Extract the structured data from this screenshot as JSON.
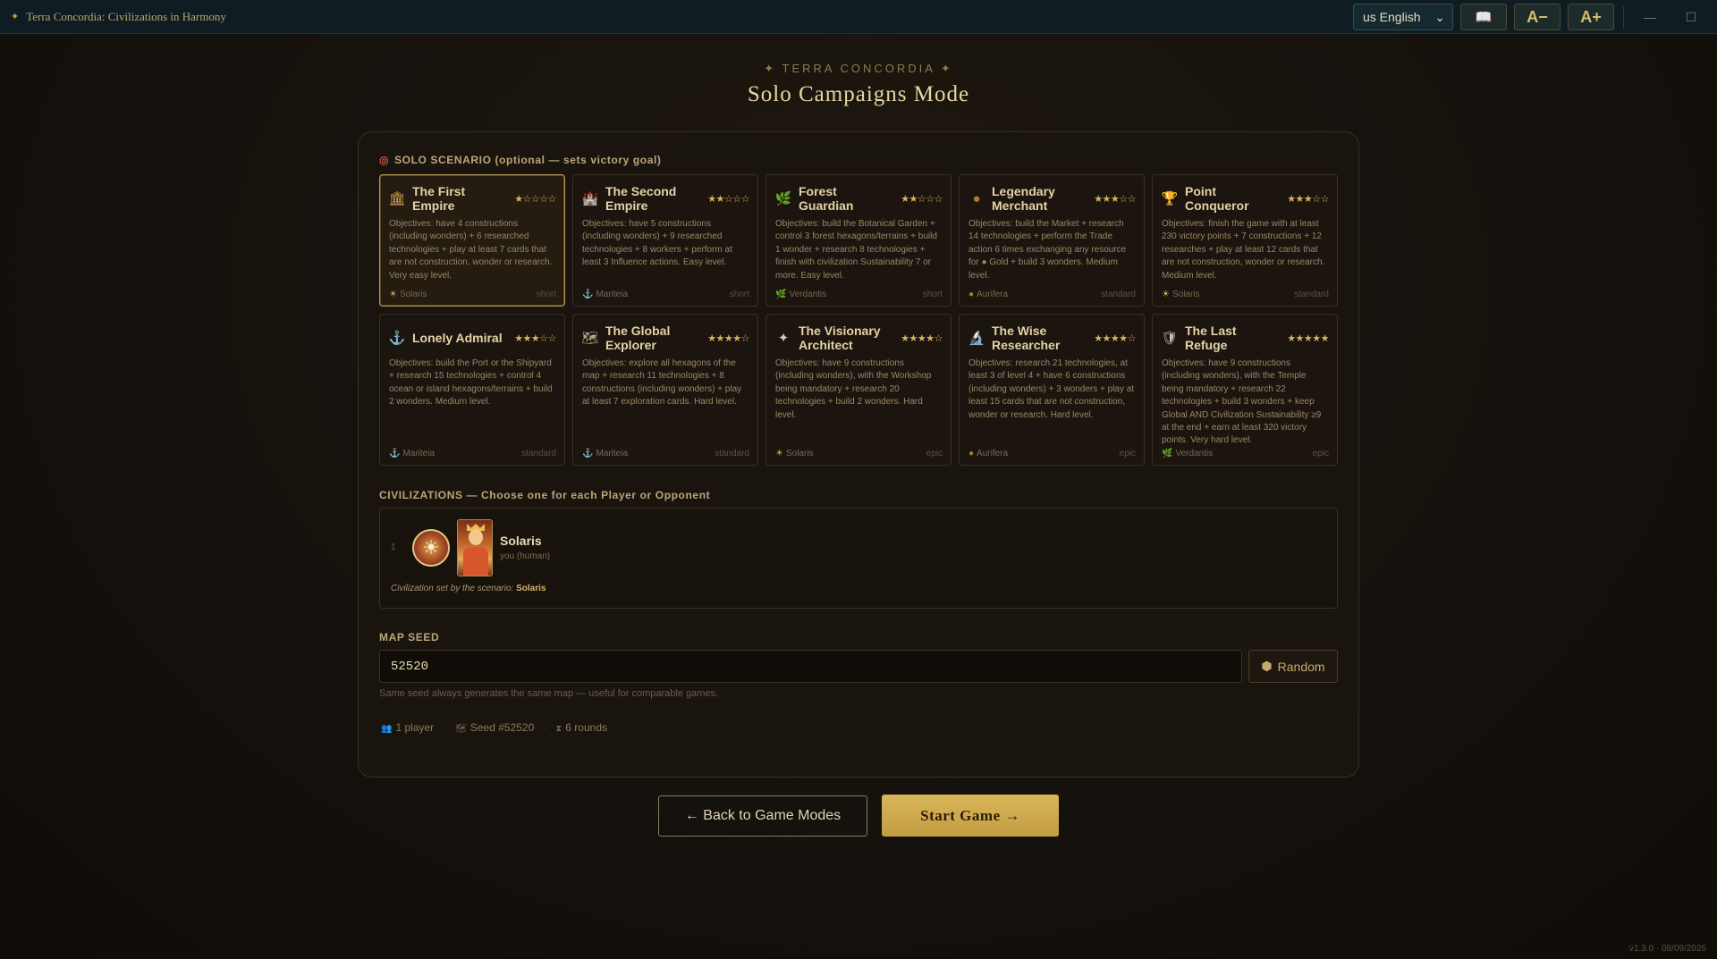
{
  "app": {
    "title": "Terra Concordia: Civilizations in Harmony",
    "language": "us English",
    "book_icon": "📖",
    "font_decrease": "A−",
    "font_increase": "A+",
    "minimize": "—",
    "maximize": "☐"
  },
  "header": {
    "eyebrow": "✦ TERRA CONCORDIA ✦",
    "title": "Solo Campaigns Mode"
  },
  "scenario_section": {
    "label": "SOLO SCENARIO (optional — sets victory goal)"
  },
  "scenarios": [
    {
      "icon": "🏛",
      "icon_name": "temple-icon",
      "title": "The First Empire",
      "stars": "★☆☆☆☆",
      "desc": "Objectives: have 4 constructions (including wonders) + 6 researched technologies + play at least 7 cards that are not construction, wonder or research. Very easy level.",
      "civ_icon": "☀",
      "civ": "Solaris",
      "length": "short",
      "selected": true
    },
    {
      "icon": "🏰",
      "icon_name": "castle-icon",
      "title": "The Second Empire",
      "stars": "★★☆☆☆",
      "desc": "Objectives: have 5 constructions (including wonders) + 9 researched technologies + 8 workers + perform at least 3 Influence actions. Easy level.",
      "civ_icon": "⚓",
      "civ": "Mariteia",
      "length": "short",
      "selected": false
    },
    {
      "icon": "🌿",
      "icon_name": "leaf-icon",
      "title": "Forest Guardian",
      "stars": "★★☆☆☆",
      "desc": "Objectives: build the Botanical Garden + control 3 forest hexagons/terrains + build 1 wonder + research 8 technologies + finish with civilization Sustainability 7 or more. Easy level.",
      "civ_icon": "🌿",
      "civ": "Verdantis",
      "length": "short",
      "selected": false
    },
    {
      "icon": "●",
      "icon_name": "gold-coin-icon",
      "title": "Legendary Merchant",
      "stars": "★★★☆☆",
      "desc": "Objectives: build the Market + research 14 technologies + perform the Trade action 6 times exchanging any resource for ● Gold + build 3 wonders. Medium level.",
      "civ_icon": "●",
      "civ": "Aurifera",
      "length": "standard",
      "selected": false
    },
    {
      "icon": "🏆",
      "icon_name": "trophy-icon",
      "title": "Point Conqueror",
      "stars": "★★★☆☆",
      "desc": "Objectives: finish the game with at least 230 victory points + 7 constructions + 12 researches + play at least 12 cards that are not construction, wonder or research. Medium level.",
      "civ_icon": "☀",
      "civ": "Solaris",
      "length": "standard",
      "selected": false
    },
    {
      "icon": "⚓",
      "icon_name": "anchor-icon",
      "title": "Lonely Admiral",
      "stars": "★★★☆☆",
      "desc": "Objectives: build the Port or the Shipyard + research 15 technologies + control 4 ocean or island hexagons/terrains + build 2 wonders. Medium level.",
      "civ_icon": "⚓",
      "civ": "Mariteia",
      "length": "standard",
      "selected": false
    },
    {
      "icon": "🗺",
      "icon_name": "map-icon",
      "title": "The Global Explorer",
      "stars": "★★★★☆",
      "desc": "Objectives: explore all hexagons of the map + research 11 technologies + 8 constructions (including wonders) + play at least 7 exploration cards. Hard level.",
      "civ_icon": "⚓",
      "civ": "Mariteia",
      "length": "standard",
      "selected": false
    },
    {
      "icon": "✦",
      "icon_name": "compass-star-icon",
      "title": "The Visionary Architect",
      "stars": "★★★★☆",
      "desc": "Objectives: have 9 constructions (including wonders), with the Workshop being mandatory + research 20 technologies + build 2 wonders. Hard level.",
      "civ_icon": "☀",
      "civ": "Solaris",
      "length": "epic",
      "selected": false
    },
    {
      "icon": "🔬",
      "icon_name": "microscope-icon",
      "title": "The Wise Researcher",
      "stars": "★★★★☆",
      "desc": "Objectives: research 21 technologies, at least 3 of level 4 + have 6 constructions (including wonders) + 3 wonders + play at least 15 cards that are not construction, wonder or research. Hard level.",
      "civ_icon": "●",
      "civ": "Aurifera",
      "length": "epic",
      "selected": false
    },
    {
      "icon": "🛡",
      "icon_name": "shield-icon",
      "title": "The Last Refuge",
      "stars": "★★★★★",
      "desc": "Objectives: have 9 constructions (including wonders), with the Temple being mandatory + research 22 technologies + build 3 wonders + keep Global AND Civilization Sustainability ≥9 at the end + earn at least 320 victory points. Very hard level.",
      "civ_icon": "🌿",
      "civ": "Verdantis",
      "length": "epic",
      "selected": false
    }
  ],
  "civilizations": {
    "label": "CIVILIZATIONS — Choose one for each Player or Opponent",
    "player_number": "1",
    "emblem": "☀",
    "name": "Solaris",
    "role": "you (human)",
    "note_prefix": "Civilization set by the scenario:",
    "note_civ": "Solaris"
  },
  "map_seed": {
    "label": "MAP SEED",
    "value": "52520",
    "random_label": "Random",
    "help": "Same seed always generates the same map — useful for comparable games."
  },
  "summary": {
    "players": "1 player",
    "seed": "Seed #52520",
    "rounds": "6 rounds"
  },
  "actions": {
    "back": "← Back to Game Modes",
    "start": "Start Game →"
  },
  "footer": {
    "version": "v1.3.0 · 08/09/2026"
  },
  "colors": {
    "accent_gold": "#d9b659",
    "background": "#15110c",
    "titlebar": "#0f1c22"
  }
}
